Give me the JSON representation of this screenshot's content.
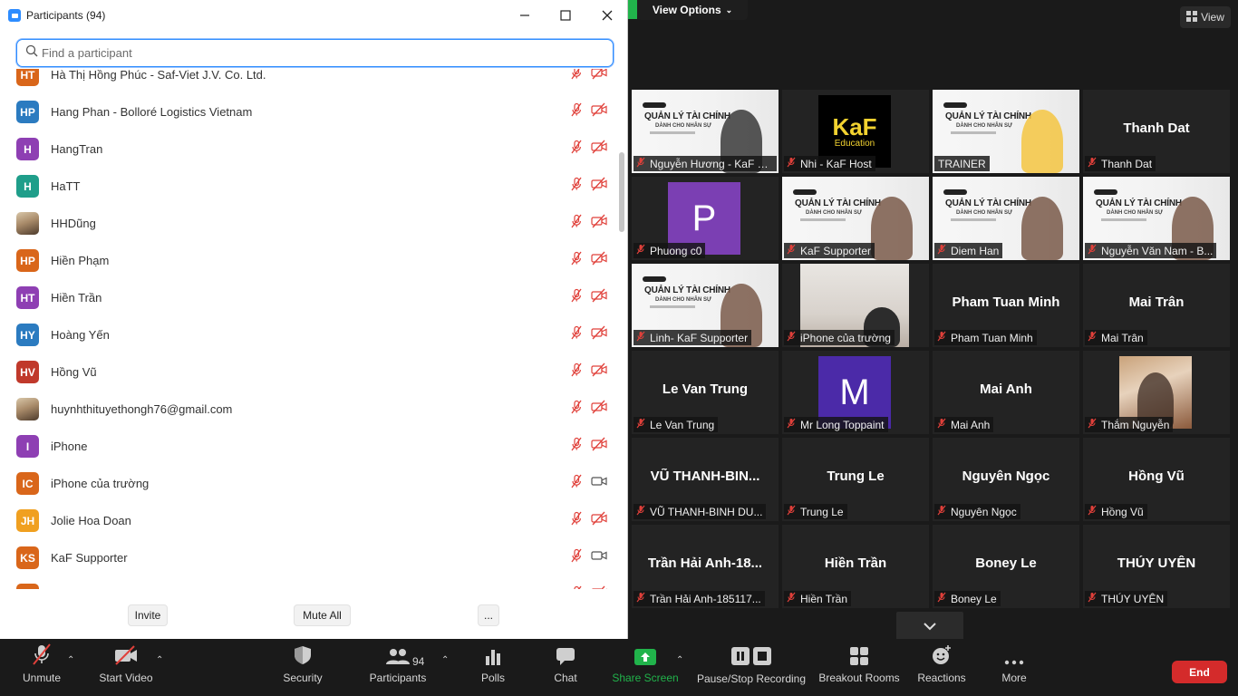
{
  "panel": {
    "title": "Participants (94)",
    "search_placeholder": "Find a participant",
    "participants": [
      {
        "initials": "HT",
        "name": "Hà Thị Hồng Phúc - Saf-Viet J.V. Co. Ltd.",
        "color": "#d9661a",
        "cam_off": true
      },
      {
        "initials": "HP",
        "name": "Hang Phan - Bolloré Logistics Vietnam",
        "color": "#2b7bc0",
        "cam_off": true
      },
      {
        "initials": "H",
        "name": "HangTran",
        "color": "#8e3fb3",
        "cam_off": true
      },
      {
        "initials": "H",
        "name": "HaTT",
        "color": "#1f9e8a",
        "cam_off": true
      },
      {
        "initials": "",
        "name": "HHDũng",
        "color": "#9c8466",
        "photo": true,
        "cam_off": true
      },
      {
        "initials": "HP",
        "name": "Hiền Phạm",
        "color": "#d9661a",
        "cam_off": true
      },
      {
        "initials": "HT",
        "name": "Hiền Trần",
        "color": "#8e3fb3",
        "cam_off": true
      },
      {
        "initials": "HY",
        "name": "Hoàng Yến",
        "color": "#2b7bc0",
        "cam_off": true
      },
      {
        "initials": "HV",
        "name": "Hồng Vũ",
        "color": "#c0392b",
        "cam_off": true
      },
      {
        "initials": "",
        "name": "huynhthituyethongh76@gmail.com",
        "color": "#c89a6b",
        "photo": true,
        "cam_off": true
      },
      {
        "initials": "I",
        "name": "iPhone",
        "color": "#8e3fb3",
        "cam_off": true
      },
      {
        "initials": "IC",
        "name": "iPhone của trường",
        "color": "#d9661a",
        "cam_off": false
      },
      {
        "initials": "JH",
        "name": "Jolie Hoa Doan",
        "color": "#f0a020",
        "cam_off": true
      },
      {
        "initials": "KS",
        "name": "KaF Supporter",
        "color": "#d9661a",
        "cam_off": false
      },
      {
        "initials": "",
        "name": "",
        "color": "#d9661a",
        "cam_off": true
      }
    ],
    "buttons": {
      "invite": "Invite",
      "mute_all": "Mute All",
      "more": "..."
    }
  },
  "top": {
    "view_options": "View Options",
    "view": "View"
  },
  "gallery": [
    {
      "name": "Nguyễn Hương - KaF Ed...",
      "kind": "webinar",
      "muted": true
    },
    {
      "name": "Nhi - KaF Host",
      "kind": "kaf",
      "muted": true,
      "logo_big": "KaF",
      "logo_small": "Education"
    },
    {
      "name": "TRAINER",
      "kind": "webinar",
      "muted": false,
      "active": true
    },
    {
      "name": "Thanh Dat",
      "kind": "text",
      "big": "Thanh Dat",
      "muted": true
    },
    {
      "name": "Phuong c0",
      "kind": "letter",
      "letter": "P",
      "color": "#7b3fb3",
      "muted": true
    },
    {
      "name": "KaF Supporter",
      "kind": "webinar",
      "muted": true
    },
    {
      "name": "Diem Han",
      "kind": "webinar",
      "muted": true
    },
    {
      "name": "Nguyễn Văn Nam - B...",
      "kind": "webinar",
      "muted": true
    },
    {
      "name": "Linh- KaF Supporter",
      "kind": "webinar",
      "muted": true
    },
    {
      "name": "iPhone của trường",
      "kind": "camera",
      "muted": true
    },
    {
      "name": "Pham Tuan Minh",
      "kind": "text",
      "big": "Pham Tuan Minh",
      "muted": true
    },
    {
      "name": "Mai Trân",
      "kind": "text",
      "big": "Mai Trân",
      "muted": true
    },
    {
      "name": "Le Van Trung",
      "kind": "text",
      "big": "Le Van Trung",
      "muted": true
    },
    {
      "name": "Mr Long Toppaint",
      "kind": "letter",
      "letter": "M",
      "color": "#4b2aa8",
      "muted": true
    },
    {
      "name": "Mai Anh",
      "kind": "text",
      "big": "Mai Anh",
      "muted": true
    },
    {
      "name": "Thắm Nguyễn",
      "kind": "photo",
      "muted": true
    },
    {
      "name": "VŨ THANH-BINH DU...",
      "kind": "text",
      "big": "VŨ THANH-BIN...",
      "muted": true
    },
    {
      "name": "Trung Le",
      "kind": "text",
      "big": "Trung Le",
      "muted": true
    },
    {
      "name": "Nguyên Ngọc",
      "kind": "text",
      "big": "Nguyên Ngọc",
      "muted": true
    },
    {
      "name": "Hồng Vũ",
      "kind": "text",
      "big": "Hồng Vũ",
      "muted": true
    },
    {
      "name": "Trần Hải Anh-185117...",
      "kind": "text",
      "big": "Trần Hải Anh-18...",
      "muted": true
    },
    {
      "name": "Hiền Trần",
      "kind": "text",
      "big": "Hiền Trần",
      "muted": true
    },
    {
      "name": "Boney Le",
      "kind": "text",
      "big": "Boney Le",
      "muted": true
    },
    {
      "name": "THÚY UYÊN",
      "kind": "text",
      "big": "THÚY UYÊN",
      "muted": true
    }
  ],
  "webinar_text": {
    "title": "QUẢN LÝ TÀI CHÍNH",
    "sub": "DÀNH CHO NHÂN SỰ"
  },
  "toolbar": {
    "unmute": "Unmute",
    "start_video": "Start Video",
    "security": "Security",
    "participants": "Participants",
    "participants_count": "94",
    "polls": "Polls",
    "chat": "Chat",
    "share_screen": "Share Screen",
    "recording": "Pause/Stop Recording",
    "breakout": "Breakout Rooms",
    "reactions": "Reactions",
    "more": "More",
    "end": "End"
  },
  "colors": {
    "accent": "#2d8cff",
    "share_green": "#21b34b",
    "end_red": "#d42b2b",
    "muted_red": "#e0403a",
    "active_outline": "#c9e86a"
  }
}
